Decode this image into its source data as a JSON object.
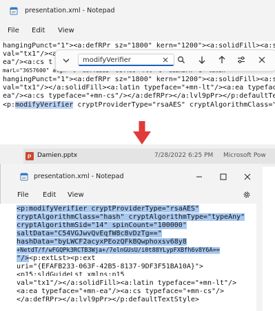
{
  "top_window": {
    "title": "presentation.xml - Notepad",
    "menu": [
      "File",
      "Edit",
      "View"
    ],
    "lines": [
      "hangingPunct=\"1\"><a:defRPr sz=\"1800\" kern=\"1200\"><a:solidFill><a:sc",
      "val=\"tx1\"/><a:defRPr sz=\"1800\" kern=\"1200\"><a:solidFill><a:sc",
      "ea\"/><a:cs t",
      "marL=\"3657600\" algn=\"l\" defTabSz=\"914400\" rtl=\"0\" eaLnBrk=\"1\" latin",
      "hangingPunct=\"1\"><a:defRPr sz=\"1800\" kern=\"1200\"><a:solidFill><a:sc",
      "val=\"tx1\"/></a:solidFill><a:latin typeface=\"+mn-lt\"/><a:ea typeface",
      "ea\"/><a:cs typeface=\"+mn-cs\"/></a:defRPr></a:lvl9pPr></p:defaultTex"
    ],
    "found_line_prefix": "<p:",
    "found_match": "modifyVerifier",
    "found_line_suffix": " cryptProviderType=\"rsaAES\" cryptAlgorithmClass=\"",
    "find": {
      "value": "modifyVerifier",
      "icons": [
        "chevron-down-icon",
        "close-icon",
        "search-icon",
        "arrow-down-icon",
        "arrow-up-icon",
        "options-icon",
        "close-icon"
      ]
    }
  },
  "arrow_color": "#e03a3a",
  "explorer_row": {
    "filename": "Damien.pptx",
    "date": "7/28/2022 6:25 PM",
    "type": "Microsoft Pow"
  },
  "bottom_window": {
    "title": "presentation.xml - Notepad",
    "menu": [
      "File",
      "Edit",
      "View"
    ],
    "selected_lines": [
      "<p:modifyVerifier cryptProviderType=\"rsaAES\"",
      "cryptAlgorithmClass=\"hash\" cryptAlgorithmType=\"typeAny\"",
      "cryptAlgorithmSid=\"14\" spinCount=\"100000\"",
      "saltData=\"C54VGJwvQvEqfW8c8vDzTg==\"",
      "hashData=\"byLWCF2acyxPEozQFkBQwphoxsv68y8",
      "+NetdT/f/wFGQPk3RCTB3Wja+/7elnGUsU/i0t88YLypFXBfh6v8Y6A==",
      "\"/>"
    ],
    "after_selection": "<p:extLst><p:ext",
    "lines": [
      "uri=\"{EFAFB233-063F-42B5-8137-9DF3F51BA10A}\">",
      "<p15:sldGuideLst xmlns:p15",
      "val=\"tx1\"/></a:solidFill><a:latin typeface=\"+mn-lt\"/>",
      "<a:ea typeface=\"+mn-ea\"/><a:cs typeface=\"+mn-cs\"/>",
      "</a:defRPr></a:lvl9pPr></p:defaultTextStyle>"
    ]
  }
}
